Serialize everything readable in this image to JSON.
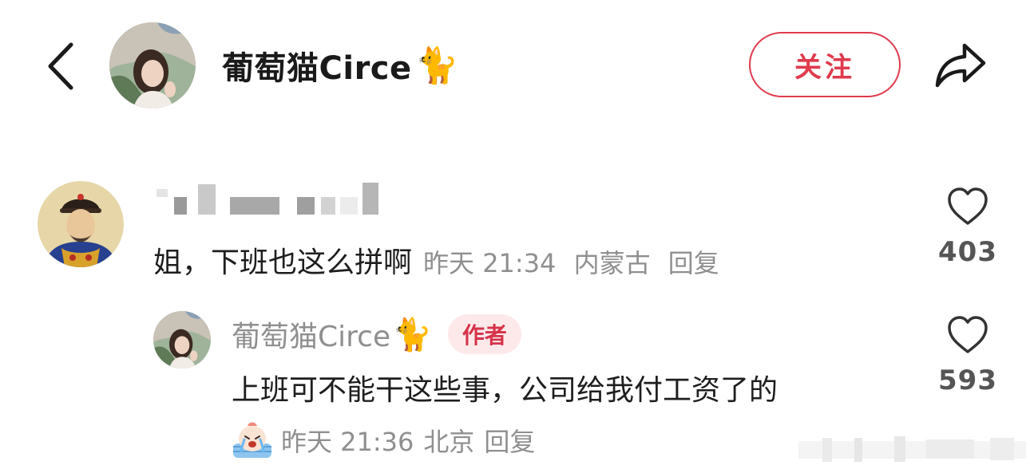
{
  "header": {
    "title": "葡萄猫Circe",
    "title_emoji": "🐈",
    "follow_label": "关注",
    "accent_color": "#e03a4d"
  },
  "comments": [
    {
      "content": "姐，下班也这么拼啊",
      "time": "昨天 21:34",
      "location": "内蒙古",
      "reply_label": "回复",
      "likes": "403",
      "replies": [
        {
          "author": "葡萄猫Circe",
          "author_emoji": "🐈",
          "badge": "作者",
          "content": "上班可不能干这些事，公司给我付工资了的",
          "time": "昨天 21:36",
          "location": "北京",
          "reply_label": "回复",
          "likes": "593"
        }
      ]
    }
  ],
  "icons": [
    "chevron-left-icon",
    "share-arrow-icon",
    "heart-outline-icon",
    "crying-sticker-icon"
  ]
}
